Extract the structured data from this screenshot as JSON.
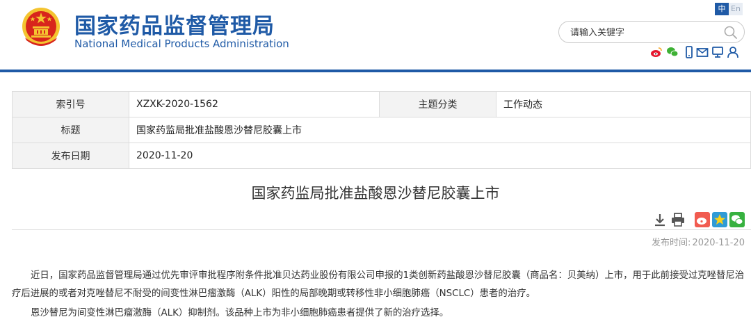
{
  "site": {
    "name_cn": "国家药品监督管理局",
    "name_en": "National Medical Products Administration"
  },
  "lang": {
    "zh": "中",
    "en": "En"
  },
  "search": {
    "placeholder": "请输入关键字"
  },
  "social_icons": [
    "weibo-icon",
    "wechat-icon",
    "mobile-icon",
    "mail-icon",
    "message-icon",
    "user-icon"
  ],
  "info_table": {
    "index_label": "索引号",
    "index_value": "XZXK-2020-1562",
    "category_label": "主题分类",
    "category_value": "工作动态",
    "title_label": "标题",
    "title_value": "国家药监局批准盐酸恩沙替尼胶囊上市",
    "date_label": "发布日期",
    "date_value": "2020-11-20"
  },
  "article": {
    "title": "国家药监局批准盐酸恩沙替尼胶囊上市",
    "tools": [
      "download-icon",
      "print-icon",
      "weibo-share-icon",
      "qzone-share-icon",
      "wechat-share-icon"
    ],
    "pubtime_label": "发布时间:",
    "pubtime_value": "2020-11-20",
    "paragraphs": [
      "近日，国家药品监督管理局通过优先审评审批程序附条件批准贝达药业股份有限公司申报的1类创新药盐酸恩沙替尼胶囊（商品名：贝美纳）上市，用于此前接受过克唑替尼治疗后进展的或者对克唑替尼不耐受的间变性淋巴瘤激酶（ALK）阳性的局部晚期或转移性非小细胞肺癌（NSCLC）患者的治疗。",
      "恩沙替尼为间变性淋巴瘤激酶（ALK）抑制剂。该品种上市为非小细胞肺癌患者提供了新的治疗选择。"
    ]
  },
  "colors": {
    "brand": "#1f5aa6",
    "emblem_red": "#d8251c",
    "emblem_gold": "#f4c430"
  }
}
